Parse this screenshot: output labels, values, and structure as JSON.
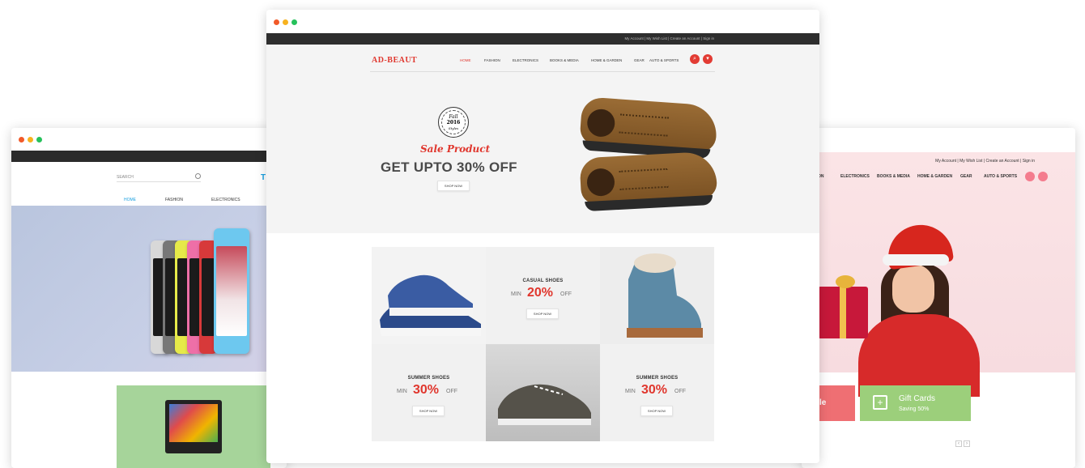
{
  "left_window": {
    "search_placeholder": "SEARCH",
    "nav": [
      "HOME",
      "FASHION",
      "ELECTRONICS"
    ],
    "logo_mark": "T"
  },
  "center_window": {
    "top_links": "My Account  |  My Wish List  |  Create an Account  |  Sign in",
    "logo": "AD-BEAUT",
    "nav": [
      "HOME",
      "FASHION",
      "ELECTRONICS",
      "BOOKS & MEDIA",
      "HOME & GARDEN",
      "GEAR",
      "AUTO & SPORTS"
    ],
    "active_nav": "HOME",
    "search_icon": "search-icon",
    "cart_icon": "cart-icon",
    "badge": {
      "line1": "Fall",
      "line2": "2016",
      "line3": "Styles"
    },
    "hero_subtitle": "Sale Product",
    "hero_title": "GET UPTO 30% OFF",
    "hero_button": "SHOP NOW",
    "tiles": [
      {
        "title": "CASUAL SHOES",
        "min": "MIN",
        "pct": "20%",
        "off": "OFF",
        "button": "SHOP NOW"
      },
      {
        "title": "SUMMER SHOES",
        "min": "MIN",
        "pct": "30%",
        "off": "OFF",
        "button": "SHOP NOW"
      },
      {
        "title": "SUMMER SHOES",
        "min": "MIN",
        "pct": "30%",
        "off": "OFF",
        "button": "SHOP NOW"
      }
    ]
  },
  "right_window": {
    "top_links": "My Account  |  My Wish List  |  Create an Account  |  Sign in",
    "nav": [
      "ON",
      "ELECTRONICS",
      "BOOKS & MEDIA",
      "HOME & GARDEN",
      "GEAR",
      "AUTO & SPORTS"
    ],
    "promo_red": "le",
    "promo_green_title": "Gift Cards",
    "promo_green_sub": "Saving 50%",
    "pager_prev": "‹",
    "pager_next": "›"
  },
  "colors": {
    "accent_red": "#e0362d",
    "pink": "#f47c8e",
    "green_promo": "#9ccf7b",
    "red_promo": "#ef6f73"
  }
}
